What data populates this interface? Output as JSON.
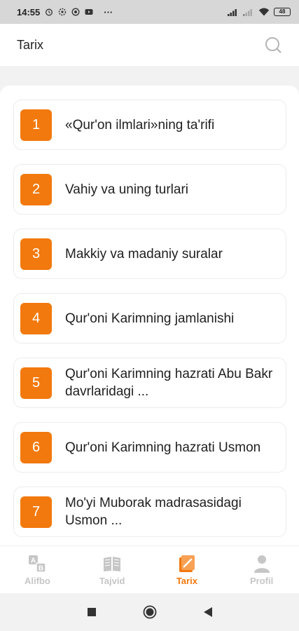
{
  "status_bar": {
    "time": "14:55",
    "dots": "···",
    "battery": "48"
  },
  "header": {
    "title": "Tarix",
    "search_icon": "search-icon"
  },
  "items": [
    {
      "number": "1",
      "label": "«Qur'on ilmlari»ning ta'rifi"
    },
    {
      "number": "2",
      "label": "Vahiy va uning turlari"
    },
    {
      "number": "3",
      "label": "Makkiy va madaniy suralar"
    },
    {
      "number": "4",
      "label": "Qur'oni Karimning jamlanishi"
    },
    {
      "number": "5",
      "label": "Qur'oni Karimning hazrati Abu Bakr davrlaridagi ..."
    },
    {
      "number": "6",
      "label": "Qur'oni Karimning hazrati Usmon"
    },
    {
      "number": "7",
      "label": "Mo'yi Muborak madrasasidagi Usmon ..."
    }
  ],
  "bottom_nav": [
    {
      "label": "Alifbo",
      "icon": "alphabet-icon",
      "active": false
    },
    {
      "label": "Tajvid",
      "icon": "book-icon",
      "active": false
    },
    {
      "label": "Tarix",
      "icon": "history-book-icon",
      "active": true
    },
    {
      "label": "Profil",
      "icon": "user-icon",
      "active": false
    }
  ],
  "colors": {
    "accent": "#f2790d",
    "inactive": "#c6c6c6",
    "background": "#f2f2f2"
  }
}
